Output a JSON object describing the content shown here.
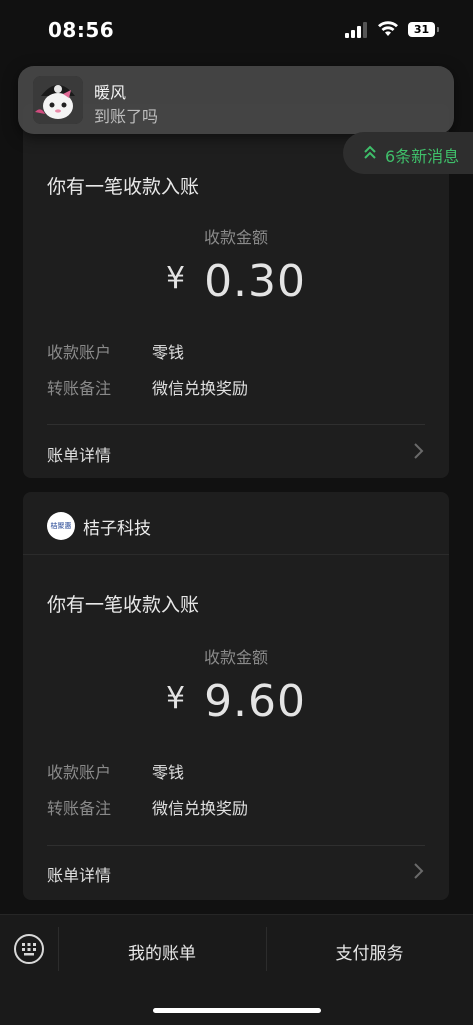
{
  "status_bar": {
    "time": "08:56",
    "battery": "31"
  },
  "notification": {
    "sender": "暖风",
    "message": "到账了吗"
  },
  "new_messages": {
    "label": "6条新消息"
  },
  "cards": [
    {
      "title": "你有一笔收款入账",
      "amount_label": "收款金额",
      "currency": "¥",
      "amount": "0.30",
      "details": [
        {
          "label": "收款账户",
          "value": "零钱"
        },
        {
          "label": "转账备注",
          "value": "微信兑换奖励"
        }
      ],
      "link": "账单详情"
    },
    {
      "merchant": "桔子科技",
      "merchant_logo_text": "桔聚惠",
      "title": "你有一笔收款入账",
      "amount_label": "收款金额",
      "currency": "¥",
      "amount": "9.60",
      "details": [
        {
          "label": "收款账户",
          "value": "零钱"
        },
        {
          "label": "转账备注",
          "value": "微信兑换奖励"
        }
      ],
      "link": "账单详情"
    }
  ],
  "bottom_bar": {
    "items": [
      "我的账单",
      "支付服务"
    ]
  },
  "colors": {
    "background": "#111111",
    "card": "#1e1e1e",
    "accent_green": "#3fbf6a"
  }
}
